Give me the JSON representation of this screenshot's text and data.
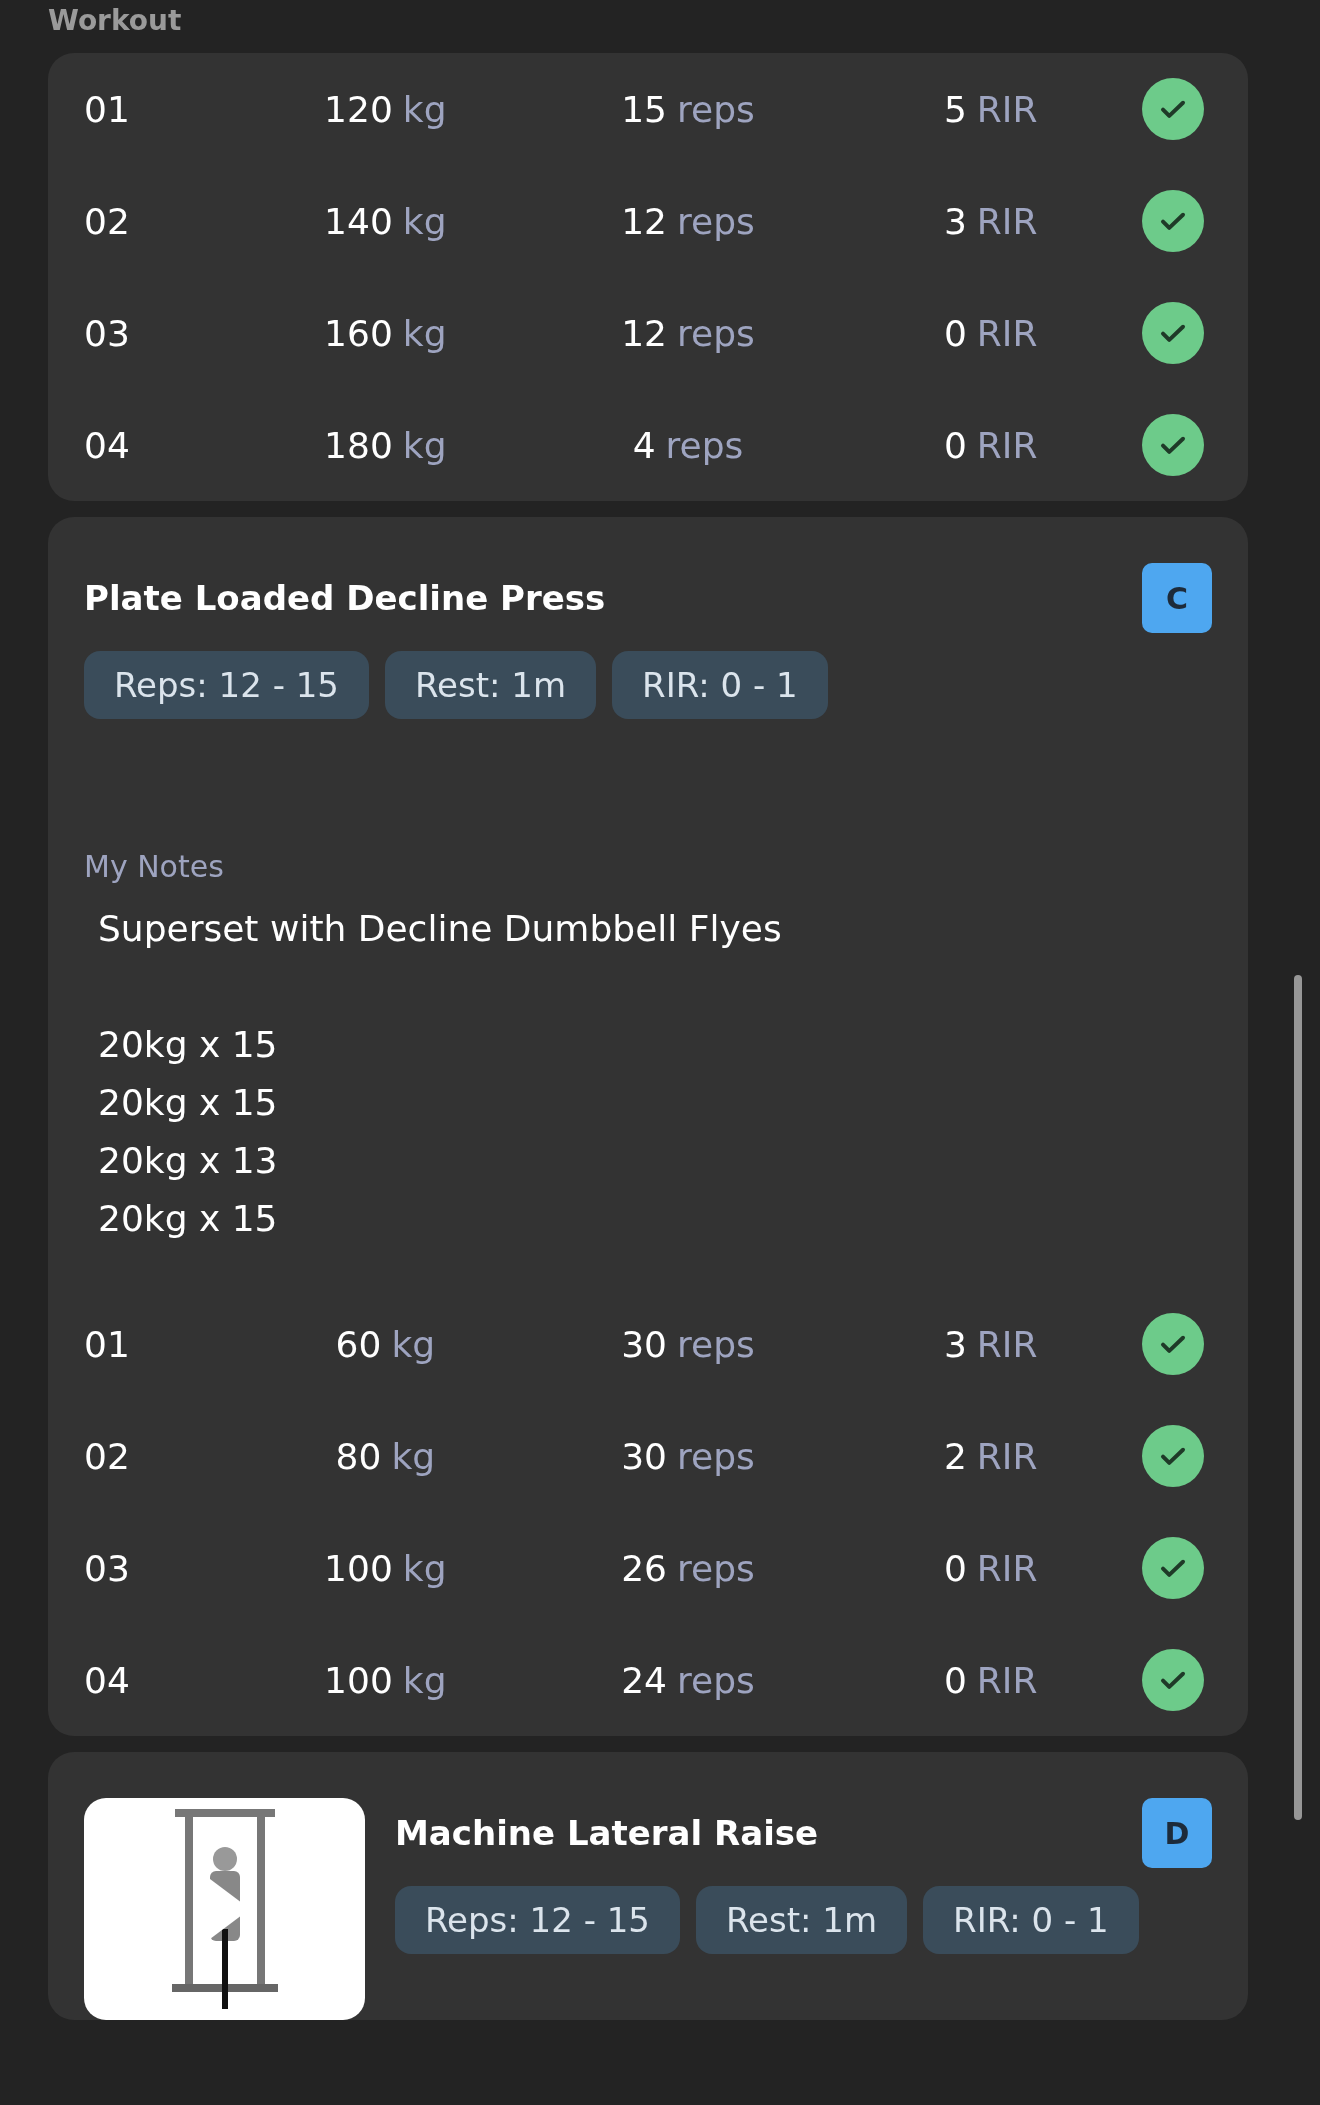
{
  "header": {
    "title": "Workout"
  },
  "exercises": [
    {
      "sets": [
        {
          "number": "01",
          "weight": "120",
          "weight_unit": "kg",
          "reps": "15",
          "reps_unit": "reps",
          "rir": "5",
          "rir_unit": "RIR",
          "done": true
        },
        {
          "number": "02",
          "weight": "140",
          "weight_unit": "kg",
          "reps": "12",
          "reps_unit": "reps",
          "rir": "3",
          "rir_unit": "RIR",
          "done": true
        },
        {
          "number": "03",
          "weight": "160",
          "weight_unit": "kg",
          "reps": "12",
          "reps_unit": "reps",
          "rir": "0",
          "rir_unit": "RIR",
          "done": true
        },
        {
          "number": "04",
          "weight": "180",
          "weight_unit": "kg",
          "reps": "4",
          "reps_unit": "reps",
          "rir": "0",
          "rir_unit": "RIR",
          "done": true
        }
      ]
    },
    {
      "title": "Plate Loaded Decline Press",
      "badge": "C",
      "chips": [
        "Reps: 12 - 15",
        "Rest: 1m",
        "RIR: 0 - 1"
      ],
      "notes_label": "My Notes",
      "notes": "Superset with Decline Dumbbell Flyes\n\n20kg x 15\n20kg x 15\n20kg x 13\n20kg x 15",
      "sets": [
        {
          "number": "01",
          "weight": "60",
          "weight_unit": "kg",
          "reps": "30",
          "reps_unit": "reps",
          "rir": "3",
          "rir_unit": "RIR",
          "done": true
        },
        {
          "number": "02",
          "weight": "80",
          "weight_unit": "kg",
          "reps": "30",
          "reps_unit": "reps",
          "rir": "2",
          "rir_unit": "RIR",
          "done": true
        },
        {
          "number": "03",
          "weight": "100",
          "weight_unit": "kg",
          "reps": "26",
          "reps_unit": "reps",
          "rir": "0",
          "rir_unit": "RIR",
          "done": true
        },
        {
          "number": "04",
          "weight": "100",
          "weight_unit": "kg",
          "reps": "24",
          "reps_unit": "reps",
          "rir": "0",
          "rir_unit": "RIR",
          "done": true
        }
      ]
    },
    {
      "title": "Machine Lateral Raise",
      "badge": "D",
      "has_video": true,
      "chips": [
        "Reps: 12 - 15",
        "Rest: 1m",
        "RIR: 0 - 1"
      ]
    }
  ]
}
